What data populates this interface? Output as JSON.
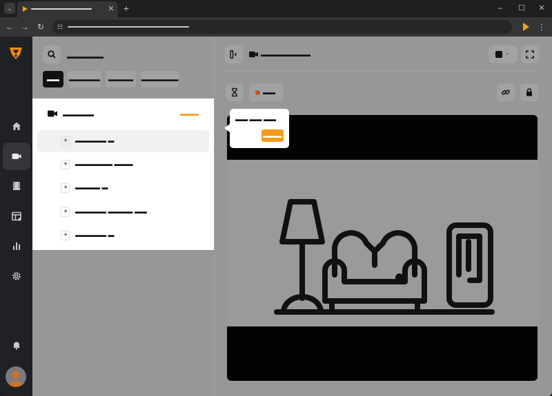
{
  "browser": {
    "tab_close": "✕",
    "new_tab": "+",
    "window_controls": {
      "minimize": "–",
      "maximize": "☐",
      "close": "✕"
    },
    "nav": {
      "back": "←",
      "forward": "→",
      "reload": "↻"
    },
    "menu": "⋮"
  },
  "colors": {
    "accent": "#f59a1b",
    "sidebar": "#202124",
    "overlay": "#979799",
    "status_dot": "#b4591a"
  },
  "sidebar": {
    "items": [
      {
        "icon": "home-icon"
      },
      {
        "icon": "camera-icon",
        "active": true
      },
      {
        "icon": "film-icon"
      },
      {
        "icon": "layout-icon"
      },
      {
        "icon": "chart-icon"
      },
      {
        "icon": "gear-icon"
      }
    ],
    "bell": "bell-icon",
    "avatar": "avatar"
  },
  "left_panel": {
    "search_label": "▬▬▬▬▬▬",
    "filters": [
      {
        "label": "▬▬",
        "active": true
      },
      {
        "label": "▬▬▬▬▬",
        "active": false
      },
      {
        "label": "▬▬▬▬",
        "active": false
      },
      {
        "label": "▬▬▬▬▬▬",
        "active": false
      }
    ]
  },
  "dropdown": {
    "title": "▬▬▬▬▬",
    "action": "▬▬▬",
    "plus": "+",
    "items": [
      {
        "label": "▬▬▬▬▬ ▬"
      },
      {
        "label": "▬▬▬▬▬▬ ▬▬▬"
      },
      {
        "label": "▬▬▬▬ ▬"
      },
      {
        "label": "▬▬▬▬▬ ▬▬▬▬ ▬▬"
      },
      {
        "label": "▬▬▬▬▬ ▬"
      }
    ]
  },
  "main": {
    "camera_title": "▬▬▬▬▬▬▬▬",
    "status_text": "▬▬",
    "select_chevron": "⌄"
  },
  "tooltip": {
    "text": "▬▬ ▬▬ ▬▬",
    "button": "▬▬▬"
  }
}
